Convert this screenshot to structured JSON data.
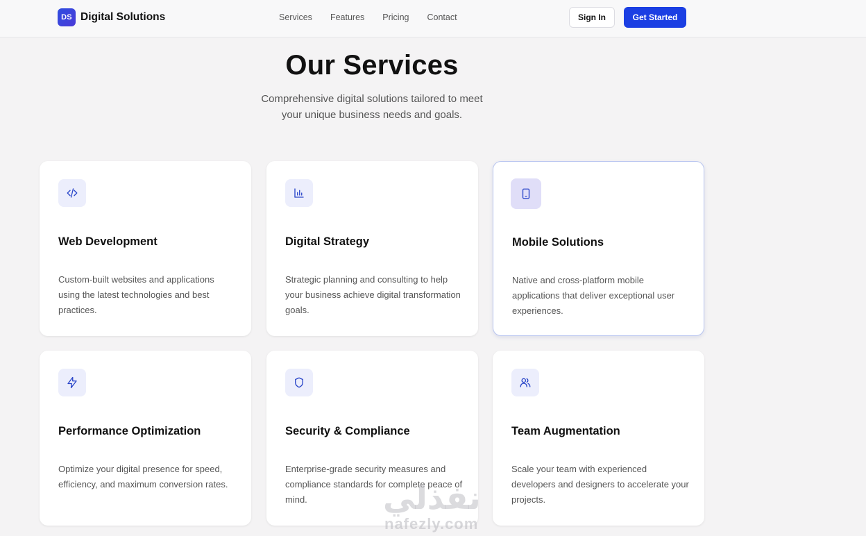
{
  "brand": {
    "logo_text": "DS",
    "name": "Digital Solutions"
  },
  "nav": {
    "links": [
      "Services",
      "Features",
      "Pricing",
      "Contact"
    ],
    "sign_in": "Sign In",
    "get_started": "Get Started"
  },
  "hero": {
    "title": "Our Services",
    "subtitle": "Comprehensive digital solutions tailored to meet your unique business needs and goals."
  },
  "services": [
    {
      "icon": "code-icon",
      "title": "Web Development",
      "desc": "Custom-built websites and applications using the latest technologies and best practices."
    },
    {
      "icon": "bar-chart-icon",
      "title": "Digital Strategy",
      "desc": "Strategic planning and consulting to help your business achieve digital transformation goals."
    },
    {
      "icon": "tablet-icon",
      "title": "Mobile Solutions",
      "desc": "Native and cross-platform mobile applications that deliver exceptional user experiences."
    },
    {
      "icon": "lightning-icon",
      "title": "Performance Optimization",
      "desc": "Optimize your digital presence for speed, efficiency, and maximum conversion rates."
    },
    {
      "icon": "shield-icon",
      "title": "Security & Compliance",
      "desc": "Enterprise-grade security measures and compliance standards for complete peace of mind."
    },
    {
      "icon": "users-icon",
      "title": "Team Augmentation",
      "desc": "Scale your team with experienced developers and designers to accelerate your projects."
    }
  ],
  "watermark": {
    "arabic": "نفذلي",
    "latin": "nafezly.com"
  },
  "colors": {
    "accent": "#1b3fe3",
    "icon_bg": "#eceefc",
    "icon_stroke": "#2a46c9",
    "background": "#f4f3f4"
  }
}
